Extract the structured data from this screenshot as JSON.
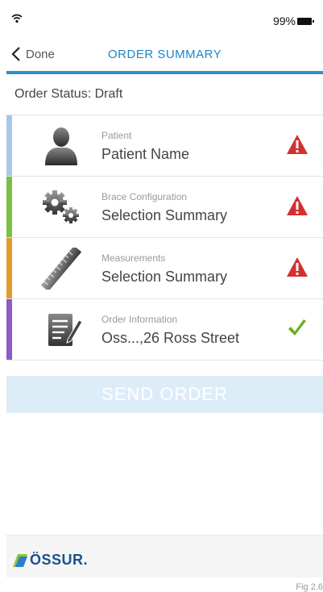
{
  "status_bar": {
    "battery": "99%"
  },
  "nav": {
    "back_label": "Done",
    "title": "ORDER SUMMARY"
  },
  "order_status": "Order Status: Draft",
  "rows": [
    {
      "subtitle": "Patient",
      "value": "Patient Name",
      "icon": "person-icon",
      "status": "warning",
      "bar_color": "#a9c8e6"
    },
    {
      "subtitle": "Brace Configuration",
      "value": "Selection Summary",
      "icon": "gears-icon",
      "status": "warning",
      "bar_color": "#7bc043"
    },
    {
      "subtitle": "Measurements",
      "value": "Selection Summary",
      "icon": "ruler-icon",
      "status": "warning",
      "bar_color": "#e59a2c"
    },
    {
      "subtitle": "Order Information",
      "value": "Oss...,26 Ross Street",
      "icon": "notepad-icon",
      "status": "complete",
      "bar_color": "#8a5bc9"
    }
  ],
  "send_button": {
    "label": "SEND ORDER"
  },
  "footer": {
    "logo": "ÖSSUR."
  },
  "figure_label": "Fig 2.6",
  "colors": {
    "accent": "#1e86c8",
    "warning": "#d32f2f",
    "check": "#6ab023"
  }
}
